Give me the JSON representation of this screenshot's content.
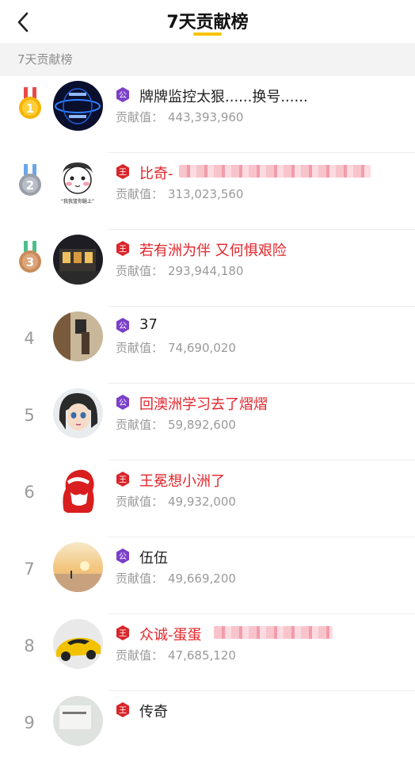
{
  "header": {
    "title": "7天贡献榜"
  },
  "section": {
    "label": "7天贡献榜"
  },
  "contrib_label": "贡献值：",
  "rows": [
    {
      "rank": "1",
      "name": "牌牌监控太狠......换号......",
      "value": "443,393,960",
      "badge": "公",
      "red": false
    },
    {
      "rank": "2",
      "name": "比奇-",
      "value": "313,023,560",
      "badge": "王",
      "red": true
    },
    {
      "rank": "3",
      "name": "若有洲为伴 又何惧艰险",
      "value": "293,944,180",
      "badge": "王",
      "red": true
    },
    {
      "rank": "4",
      "name": "37",
      "value": "74,690,020",
      "badge": "公",
      "red": false
    },
    {
      "rank": "5",
      "name": "回澳洲学习去了熠熠",
      "value": "59,892,600",
      "badge": "公",
      "red": true
    },
    {
      "rank": "6",
      "name": "王冕想小洲了",
      "value": "49,932,000",
      "badge": "王",
      "red": true
    },
    {
      "rank": "7",
      "name": "伍伍",
      "value": "49,669,200",
      "badge": "公",
      "red": false
    },
    {
      "rank": "8",
      "name": "众诚-蛋蛋",
      "value": "47,685,120",
      "badge": "王",
      "red": true
    },
    {
      "rank": "9",
      "name": "传奇",
      "value": "",
      "badge": "王",
      "red": false
    }
  ],
  "avatar2_caption": "“我我篮你腿上”",
  "colors": {
    "accent": "#f8c300",
    "red_name": "#e3252b",
    "vip_purple": "#7b3fc8",
    "king_red": "#d8262b"
  }
}
